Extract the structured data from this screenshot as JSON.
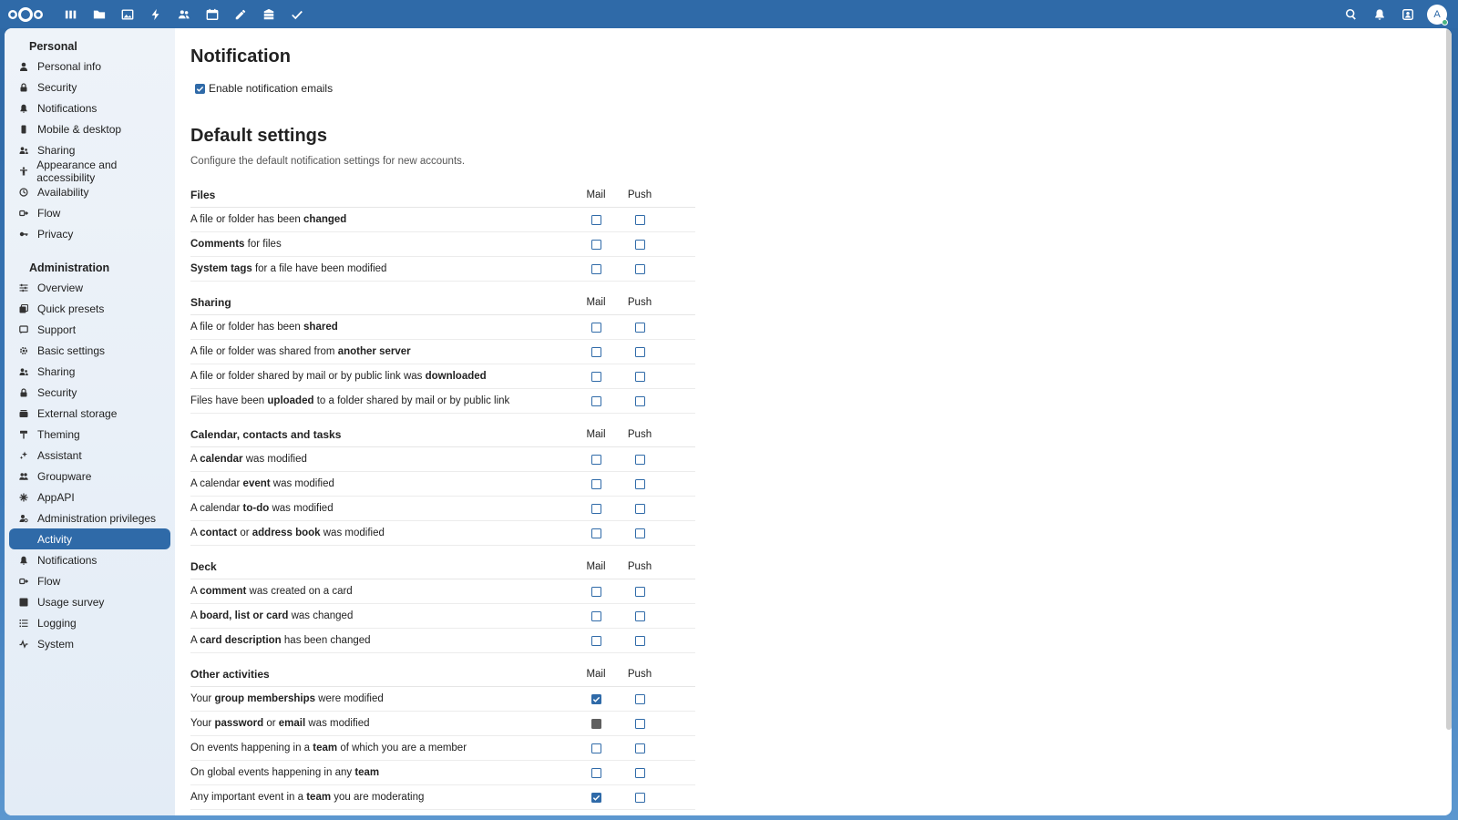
{
  "topbar": {
    "apps": [
      {
        "name": "dashboard",
        "icon": "dashboard-icon"
      },
      {
        "name": "files",
        "icon": "folder-icon"
      },
      {
        "name": "photos",
        "icon": "image-icon"
      },
      {
        "name": "activity",
        "icon": "lightning-icon"
      },
      {
        "name": "contacts",
        "icon": "contacts-icon"
      },
      {
        "name": "calendar",
        "icon": "calendar-icon"
      },
      {
        "name": "notes",
        "icon": "pencil-icon"
      },
      {
        "name": "deck",
        "icon": "deck-icon"
      },
      {
        "name": "tasks",
        "icon": "check-icon"
      }
    ],
    "avatar_initial": "A"
  },
  "sidebar": {
    "personal_heading": "Personal",
    "personal_items": [
      {
        "label": "Personal info",
        "icon": "user-icon"
      },
      {
        "label": "Security",
        "icon": "lock-icon"
      },
      {
        "label": "Notifications",
        "icon": "bell-icon"
      },
      {
        "label": "Mobile & desktop",
        "icon": "phone-icon"
      },
      {
        "label": "Sharing",
        "icon": "share-icon"
      },
      {
        "label": "Appearance and accessibility",
        "icon": "accessibility-icon"
      },
      {
        "label": "Availability",
        "icon": "clock-icon"
      },
      {
        "label": "Flow",
        "icon": "flow-icon"
      },
      {
        "label": "Privacy",
        "icon": "key-icon"
      }
    ],
    "admin_heading": "Administration",
    "admin_items": [
      {
        "label": "Overview",
        "icon": "sliders-icon"
      },
      {
        "label": "Quick presets",
        "icon": "presets-icon"
      },
      {
        "label": "Support",
        "icon": "support-icon"
      },
      {
        "label": "Basic settings",
        "icon": "gear-icon"
      },
      {
        "label": "Sharing",
        "icon": "share-icon"
      },
      {
        "label": "Security",
        "icon": "lock-icon"
      },
      {
        "label": "External storage",
        "icon": "storage-icon"
      },
      {
        "label": "Theming",
        "icon": "paint-icon"
      },
      {
        "label": "Assistant",
        "icon": "sparkle-icon"
      },
      {
        "label": "Groupware",
        "icon": "group-icon"
      },
      {
        "label": "AppAPI",
        "icon": "api-icon"
      },
      {
        "label": "Administration privileges",
        "icon": "admin-icon"
      },
      {
        "label": "Activity",
        "icon": "lightning-icon",
        "active": true
      },
      {
        "label": "Notifications",
        "icon": "bell-icon"
      },
      {
        "label": "Flow",
        "icon": "flow-icon"
      },
      {
        "label": "Usage survey",
        "icon": "chart-icon"
      },
      {
        "label": "Logging",
        "icon": "list-icon"
      },
      {
        "label": "System",
        "icon": "pulse-icon"
      }
    ]
  },
  "main": {
    "title": "Notification",
    "enable_label": "Enable notification emails",
    "enable_checked": true,
    "default_title": "Default settings",
    "default_desc": "Configure the default notification settings for new accounts.",
    "col_mail": "Mail",
    "col_push": "Push",
    "sections": [
      {
        "name": "Files",
        "rows": [
          {
            "parts": [
              [
                "A file or folder has been ",
                false
              ],
              [
                "changed",
                true
              ]
            ],
            "mail": "off",
            "push": "off"
          },
          {
            "parts": [
              [
                "Comments",
                true
              ],
              [
                " for files",
                false
              ]
            ],
            "mail": "off",
            "push": "off"
          },
          {
            "parts": [
              [
                "System tags",
                true
              ],
              [
                " for a file have been modified",
                false
              ]
            ],
            "mail": "off",
            "push": "off"
          }
        ]
      },
      {
        "name": "Sharing",
        "rows": [
          {
            "parts": [
              [
                "A file or folder has been ",
                false
              ],
              [
                "shared",
                true
              ]
            ],
            "mail": "off",
            "push": "off"
          },
          {
            "parts": [
              [
                "A file or folder was shared from ",
                false
              ],
              [
                "another server",
                true
              ]
            ],
            "mail": "off",
            "push": "off"
          },
          {
            "parts": [
              [
                "A file or folder shared by mail or by public link was ",
                false
              ],
              [
                "downloaded",
                true
              ]
            ],
            "mail": "off",
            "push": "off"
          },
          {
            "parts": [
              [
                "Files have been ",
                false
              ],
              [
                "uploaded",
                true
              ],
              [
                " to a folder shared by mail or by public link",
                false
              ]
            ],
            "mail": "off",
            "push": "off"
          }
        ]
      },
      {
        "name": "Calendar, contacts and tasks",
        "rows": [
          {
            "parts": [
              [
                "A ",
                false
              ],
              [
                "calendar",
                true
              ],
              [
                " was modified",
                false
              ]
            ],
            "mail": "off",
            "push": "off"
          },
          {
            "parts": [
              [
                "A calendar ",
                false
              ],
              [
                "event",
                true
              ],
              [
                " was modified",
                false
              ]
            ],
            "mail": "off",
            "push": "off"
          },
          {
            "parts": [
              [
                "A calendar ",
                false
              ],
              [
                "to-do",
                true
              ],
              [
                " was modified",
                false
              ]
            ],
            "mail": "off",
            "push": "off"
          },
          {
            "parts": [
              [
                "A ",
                false
              ],
              [
                "contact",
                true
              ],
              [
                " or ",
                false
              ],
              [
                "address book",
                true
              ],
              [
                " was modified",
                false
              ]
            ],
            "mail": "off",
            "push": "off"
          }
        ]
      },
      {
        "name": "Deck",
        "rows": [
          {
            "parts": [
              [
                "A ",
                false
              ],
              [
                "comment",
                true
              ],
              [
                " was created on a card",
                false
              ]
            ],
            "mail": "off",
            "push": "off"
          },
          {
            "parts": [
              [
                "A ",
                false
              ],
              [
                "board, list or card",
                true
              ],
              [
                " was changed",
                false
              ]
            ],
            "mail": "off",
            "push": "off"
          },
          {
            "parts": [
              [
                "A ",
                false
              ],
              [
                "card description",
                true
              ],
              [
                " has been changed",
                false
              ]
            ],
            "mail": "off",
            "push": "off"
          }
        ]
      },
      {
        "name": "Other activities",
        "rows": [
          {
            "parts": [
              [
                "Your ",
                false
              ],
              [
                "group memberships",
                true
              ],
              [
                " were modified",
                false
              ]
            ],
            "mail": "on",
            "push": "off"
          },
          {
            "parts": [
              [
                "Your ",
                false
              ],
              [
                "password",
                true
              ],
              [
                " or ",
                false
              ],
              [
                "email",
                true
              ],
              [
                " was modified",
                false
              ]
            ],
            "mail": "disabled",
            "push": "off"
          },
          {
            "parts": [
              [
                "On events happening in a ",
                false
              ],
              [
                "team",
                true
              ],
              [
                " of which you are a member",
                false
              ]
            ],
            "mail": "off",
            "push": "off"
          },
          {
            "parts": [
              [
                "On global events happening in any ",
                false
              ],
              [
                "team",
                true
              ]
            ],
            "mail": "off",
            "push": "off"
          },
          {
            "parts": [
              [
                "Any important event in a ",
                false
              ],
              [
                "team",
                true
              ],
              [
                " you are moderating",
                false
              ]
            ],
            "mail": "on",
            "push": "off"
          }
        ]
      }
    ]
  },
  "colors": {
    "primary": "#2f6aa8",
    "disabled_checkbox": "#5f5f5f"
  }
}
